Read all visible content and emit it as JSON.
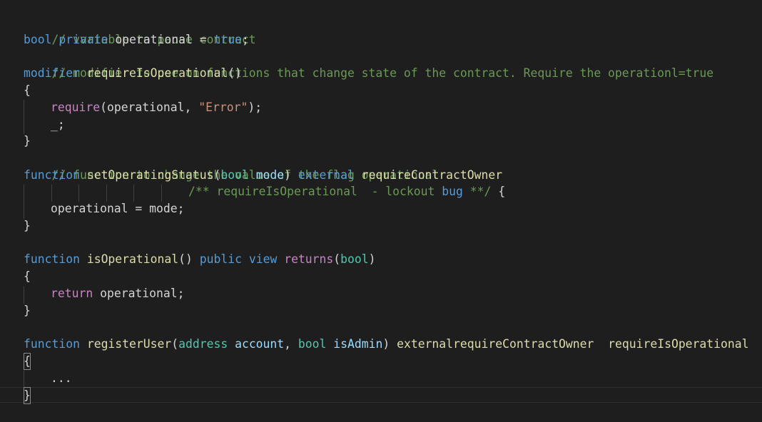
{
  "colors": {
    "background": "#1e1e1e",
    "text": "#d4d4d4",
    "comment": "#6a9955",
    "keyword": "#569cd6",
    "control": "#c586c0",
    "function": "#dcdcaa",
    "string": "#ce9178",
    "variable": "#9cdcfe",
    "type": "#4ec9b0",
    "indent_guide": "#404040"
  },
  "code": {
    "line1": {
      "comment": "// variable to pause contract"
    },
    "line2": {
      "kw_bool": "bool",
      "kw_private": "private",
      "name": "operational",
      "eq": " = ",
      "kw_true": "true",
      "semi": ";"
    },
    "line3": {
      "comment": "// modifier to use on functions that change state of the contract. Require the operationl=true"
    },
    "line4": {
      "kw_modifier": "modifier",
      "name": "requireIsOperational",
      "parens": "()"
    },
    "line5": {
      "brace": "{"
    },
    "line6": {
      "fn": "require",
      "open": "(",
      "arg": "operational",
      "comma": ", ",
      "str": "\"Error\"",
      "close": ");"
    },
    "line7": {
      "text": "_;"
    },
    "line8": {
      "brace": "}"
    },
    "line9": {
      "comment": "// function to change the value of the flag operational"
    },
    "line10": {
      "kw_function": "function",
      "name": "setOperatingStatus",
      "open": "(",
      "type": "bool",
      "param": "mode",
      "close": ")",
      "kw_external": "external",
      "modifier": "requireContractOwner"
    },
    "line11": {
      "comment_start": "/** requireIsOperational  - lockout ",
      "comment_bug": "bug",
      "comment_end": " **/",
      "brace": " {"
    },
    "line12": {
      "lhs": "operational",
      "eq": " = ",
      "rhs": "mode",
      "semi": ";"
    },
    "line13": {
      "brace": "}"
    },
    "line15": {
      "kw_function": "function",
      "name": "isOperational",
      "parens": "()",
      "kw_public": "public",
      "kw_view": "view",
      "kw_returns": "returns",
      "open": "(",
      "type": "bool",
      "close": ")"
    },
    "line16": {
      "brace": "{"
    },
    "line17": {
      "kw_return": "return",
      "name": "operational",
      "semi": ";"
    },
    "line18": {
      "brace": "}"
    },
    "line20": {
      "kw_function": "function",
      "name": "registerUser",
      "open": "(",
      "type1": "address",
      "param1": "account",
      "comma": ", ",
      "type2": "bool",
      "param2": "isAdmin",
      "close": ")",
      "modifiers": "externalrequireContractOwner  requireIsOperational"
    },
    "line21": {
      "brace": "{"
    },
    "line22": {
      "text": "..."
    },
    "line23": {
      "brace": "}"
    }
  }
}
